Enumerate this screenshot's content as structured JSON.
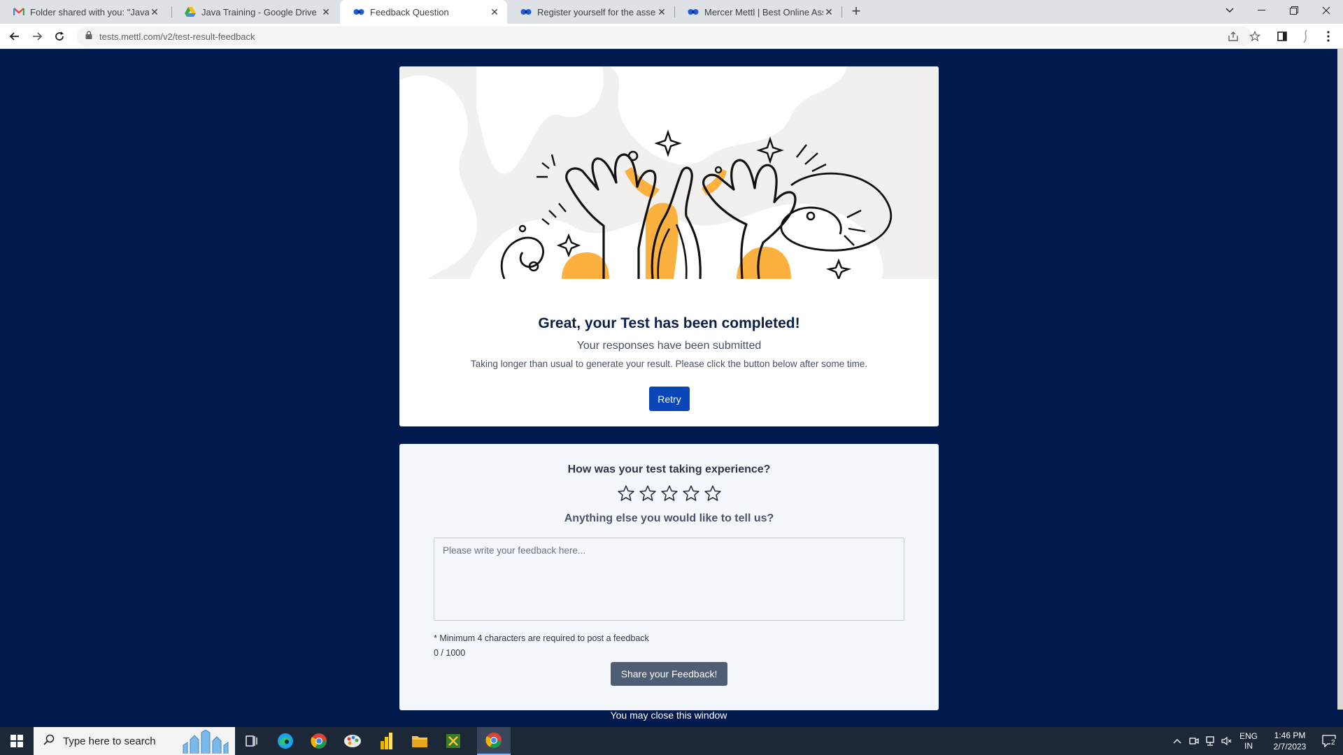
{
  "browser": {
    "tabs": [
      {
        "label": "Folder shared with you: \"Java Tra",
        "icon": "gmail-icon",
        "active": false
      },
      {
        "label": "Java Training - Google Drive",
        "icon": "google-drive-icon",
        "active": false
      },
      {
        "label": "Feedback Question",
        "icon": "mettl-icon",
        "active": true
      },
      {
        "label": "Register yourself for the assessm",
        "icon": "mettl-icon",
        "active": false
      },
      {
        "label": "Mercer Mettl | Best Online Asses",
        "icon": "mettl-icon",
        "active": false
      }
    ],
    "url": "tests.mettl.com/v2/test-result-feedback"
  },
  "result": {
    "title": "Great, your Test has been completed!",
    "subtitle": "Your responses have been submitted",
    "note": "Taking longer than usual to generate your result. Please click the button below after some time.",
    "retry_label": "Retry"
  },
  "feedback": {
    "question": "How was your test taking experience?",
    "rating": 0,
    "max_rating": 5,
    "else_question": "Anything else you would like to tell us?",
    "placeholder": "Please write your feedback here...",
    "min_note": "* Minimum 4 characters are required to post a feedback",
    "counter": "0 / 1000",
    "share_label": "Share your Feedback!"
  },
  "footer": {
    "close_message": "You may close this window"
  },
  "taskbar": {
    "search_placeholder": "Type here to search",
    "lang_line1": "ENG",
    "lang_line2": "IN",
    "time": "1:46 PM",
    "date": "2/7/2023",
    "notification_count": "2"
  },
  "colors": {
    "page_background": "#001a4d",
    "retry_button": "#0b46b8",
    "share_button": "#4f5d75",
    "hero_accent": "#fbb040"
  }
}
